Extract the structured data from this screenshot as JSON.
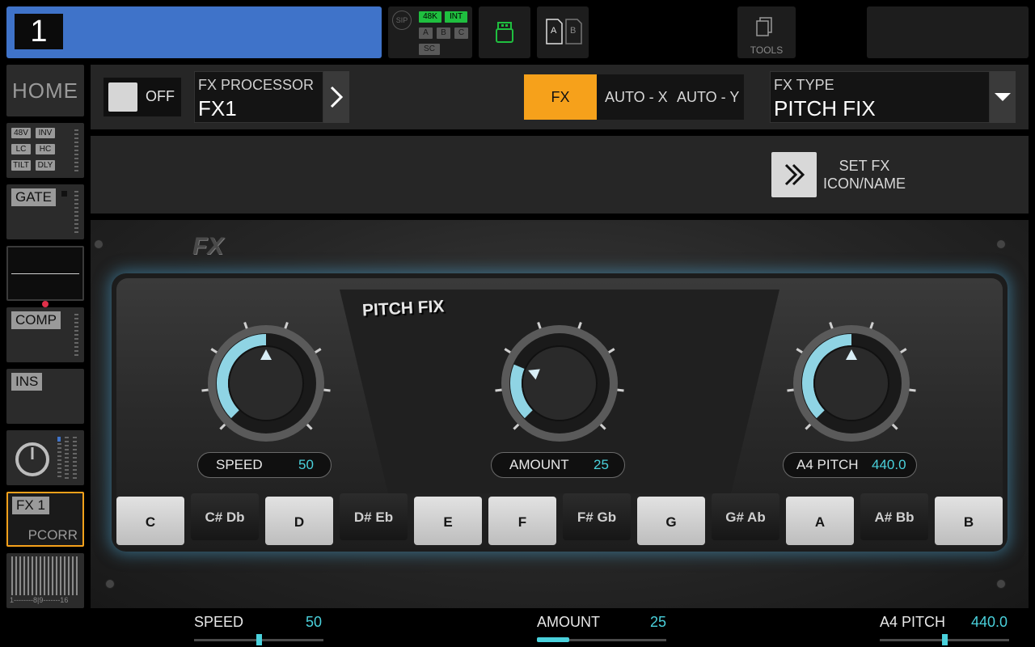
{
  "topbar": {
    "channel_number": "1",
    "sip_label": "SIP",
    "rate_tag": "48K",
    "clock_tag": "INT",
    "bank_tags": [
      "A",
      "B",
      "C"
    ],
    "sc_tag": "SC",
    "card_a": "A",
    "card_b": "B",
    "tools_label": "TOOLS"
  },
  "sidebar": {
    "home_label": "HOME",
    "input_tags": [
      "48V",
      "INV",
      "LC",
      "HC",
      "TILT",
      "DLY"
    ],
    "gate_label": "GATE",
    "comp_label": "COMP",
    "ins_label": "INS",
    "fx_label": "FX 1",
    "fx_sub": "PCORR",
    "meter_scale": "1--------8|9-------16"
  },
  "header": {
    "toggle_label": "OFF",
    "processor_caption": "FX PROCESSOR",
    "processor_value": "FX1",
    "seg_fx": "FX",
    "seg_autox": "AUTO - X",
    "seg_autoy": "AUTO - Y",
    "type_caption": "FX TYPE",
    "type_value": "PITCH FIX",
    "set_fx_line1": "SET FX",
    "set_fx_line2": "ICON/NAME"
  },
  "plugin": {
    "fx_logo": "FX",
    "title": "PITCH FIX",
    "knobs": [
      {
        "name": "SPEED",
        "value": "50",
        "level": 0.5
      },
      {
        "name": "AMOUNT",
        "value": "25",
        "level": 0.25
      },
      {
        "name": "A4 PITCH",
        "value": "440.0",
        "level": 0.5
      }
    ],
    "keys": [
      {
        "label": "C",
        "type": "w"
      },
      {
        "label": "C# Db",
        "type": "b"
      },
      {
        "label": "D",
        "type": "w"
      },
      {
        "label": "D# Eb",
        "type": "b"
      },
      {
        "label": "E",
        "type": "w"
      },
      {
        "label": "F",
        "type": "w"
      },
      {
        "label": "F# Gb",
        "type": "b"
      },
      {
        "label": "G",
        "type": "w"
      },
      {
        "label": "G# Ab",
        "type": "b"
      },
      {
        "label": "A",
        "type": "w"
      },
      {
        "label": "A# Bb",
        "type": "b"
      },
      {
        "label": "B",
        "type": "w"
      }
    ]
  },
  "bottom": {
    "params": [
      {
        "label": "SPEED",
        "value": "50",
        "level": 0.5
      },
      {
        "label": "AMOUNT",
        "value": "25",
        "level": 0.25
      },
      {
        "label": "A4 PITCH",
        "value": "440.0",
        "level": 0.5
      }
    ]
  },
  "colors": {
    "channel": "#3f73c9",
    "accent": "#f6a11b",
    "value": "#4ad1dc",
    "fx_border": "#f6a11b",
    "green_tag": "#1fbf3f"
  }
}
